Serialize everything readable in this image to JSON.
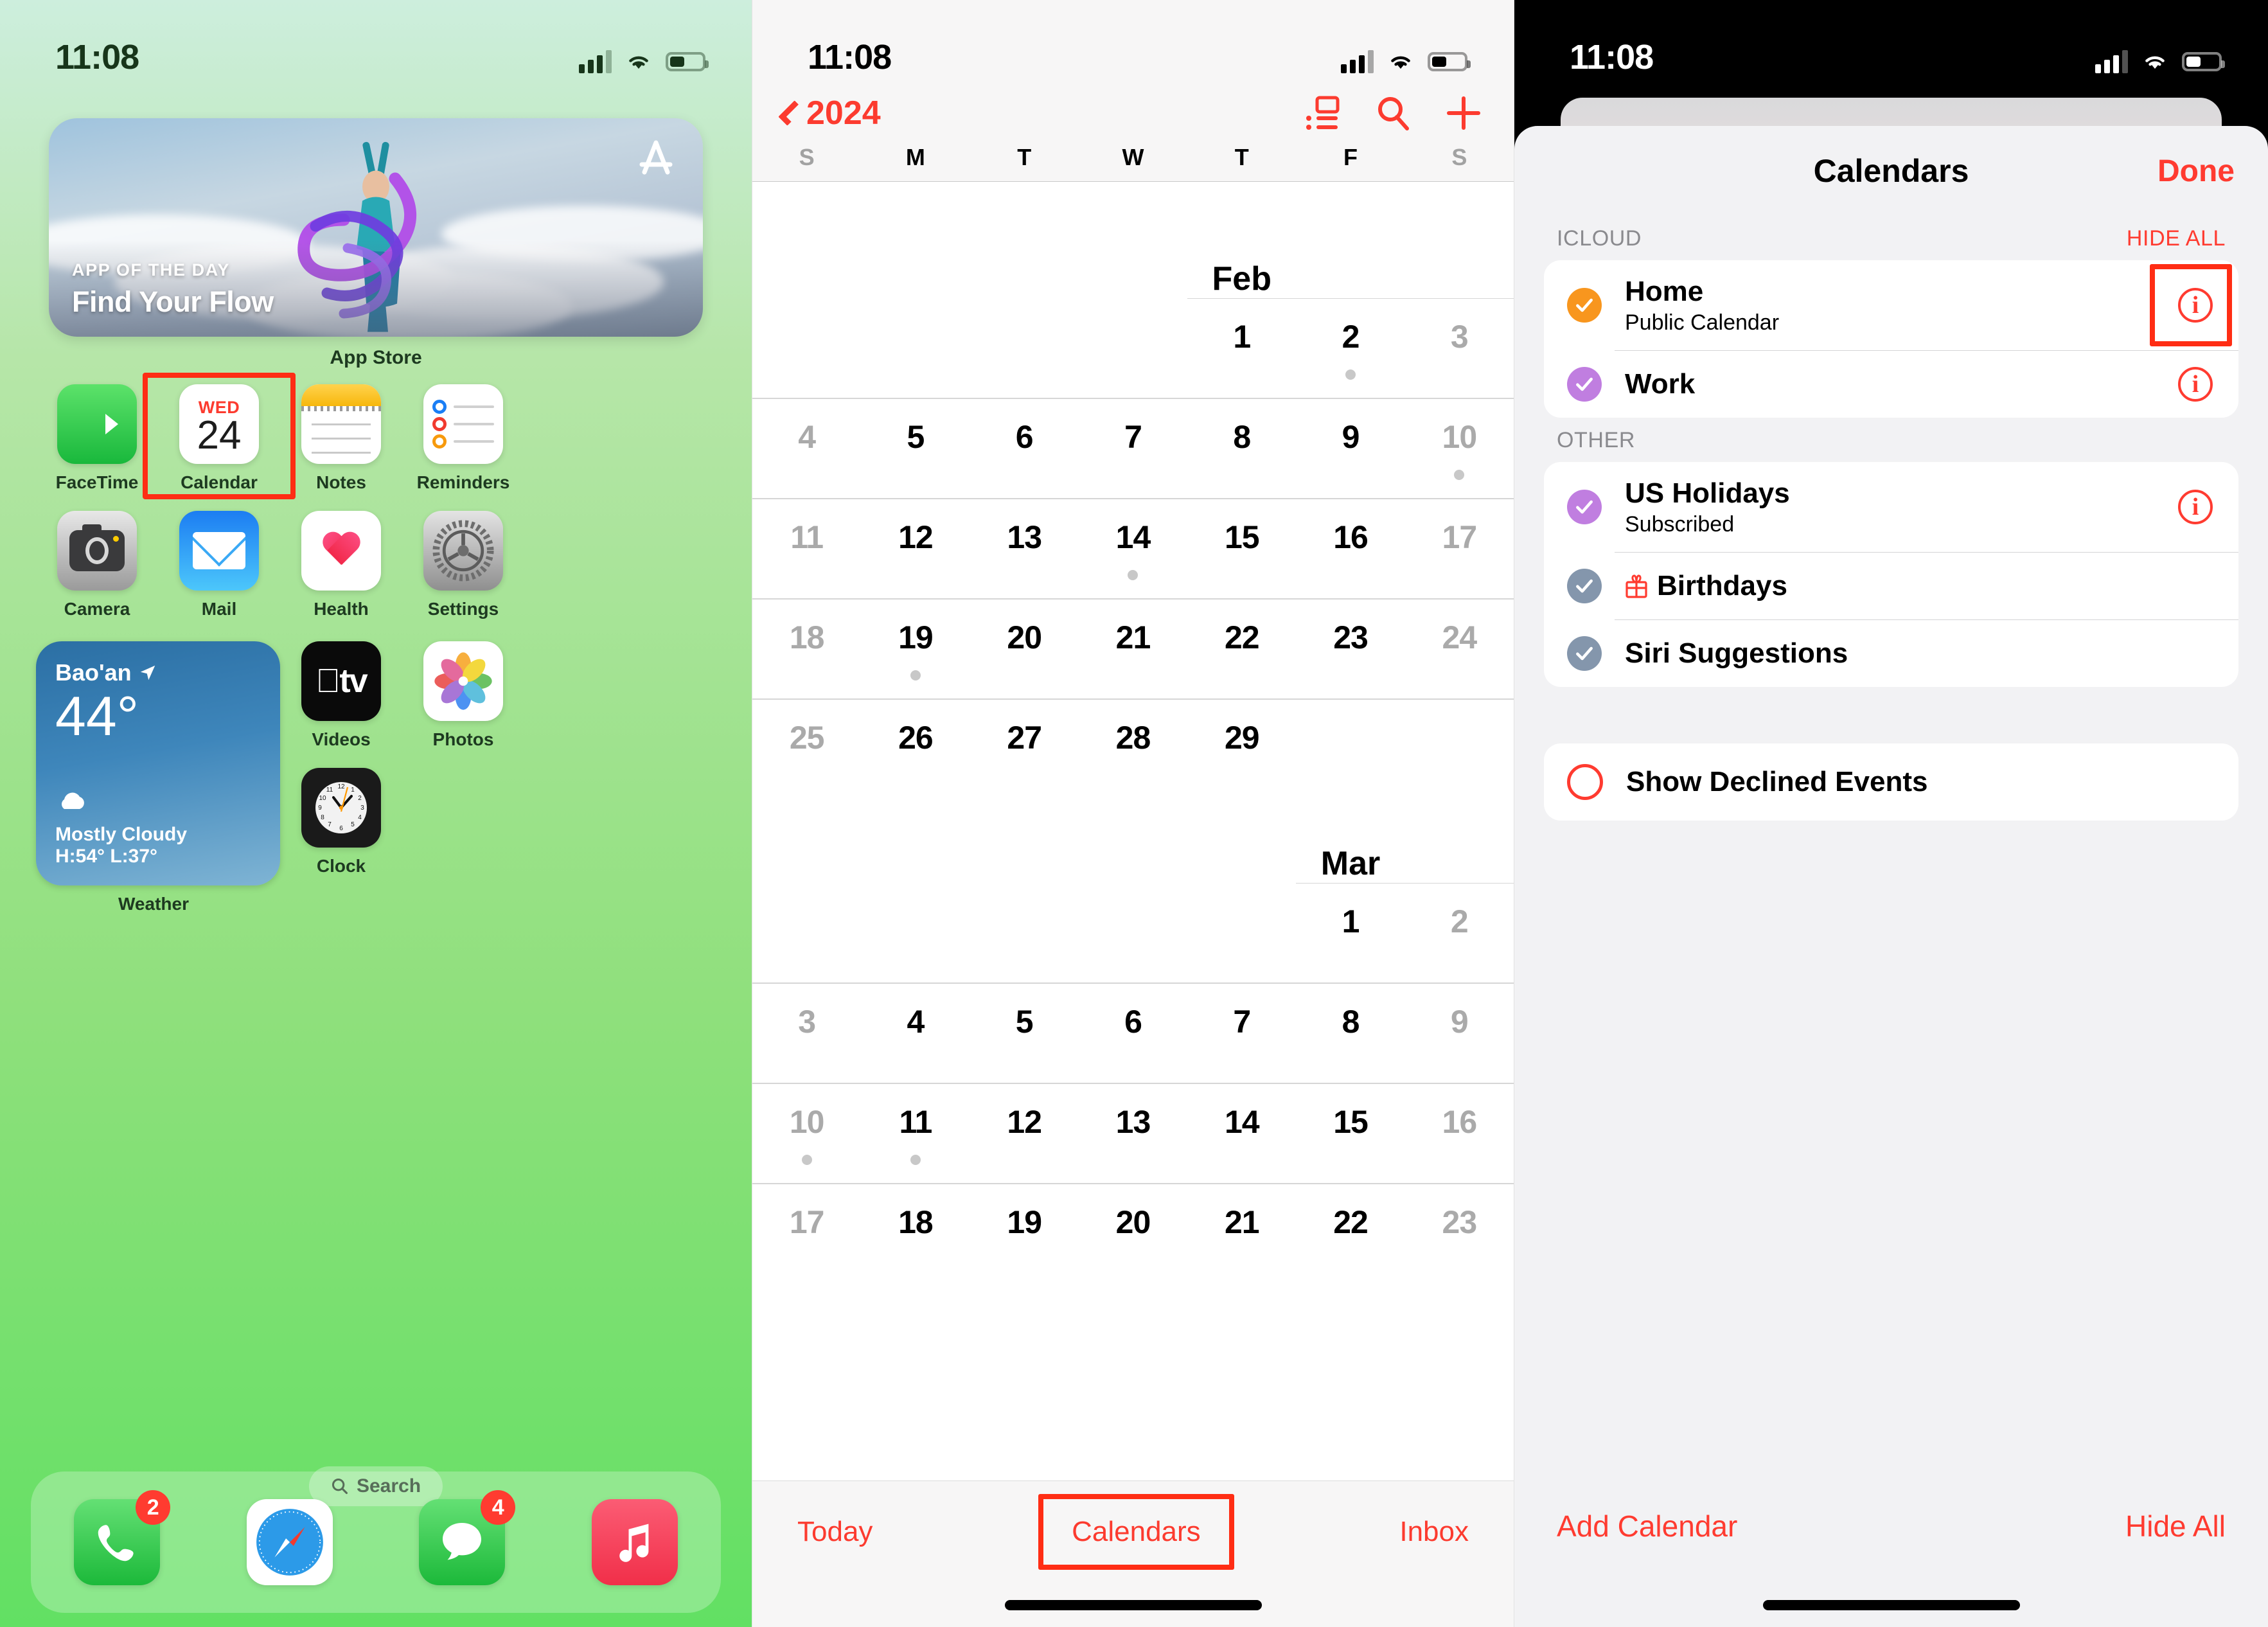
{
  "status_bar": {
    "time": "11:08",
    "icons": [
      "cellular-signal-icon",
      "wifi-icon",
      "battery-icon"
    ]
  },
  "home_screen": {
    "widget": {
      "kicker": "APP OF THE DAY",
      "title": "Find Your Flow",
      "label": "App Store",
      "icon": "app-store-icon"
    },
    "rows": [
      [
        {
          "label": "FaceTime",
          "icon": "facetime-icon",
          "selected": false
        },
        {
          "label": "Calendar",
          "icon": "calendar-icon",
          "selected": true,
          "dow": "WED",
          "day": "24"
        },
        {
          "label": "Notes",
          "icon": "notes-icon",
          "selected": false
        },
        {
          "label": "Reminders",
          "icon": "reminders-icon",
          "selected": false
        }
      ],
      [
        {
          "label": "Camera",
          "icon": "camera-icon",
          "selected": false
        },
        {
          "label": "Mail",
          "icon": "mail-icon",
          "selected": false
        },
        {
          "label": "Health",
          "icon": "health-icon",
          "selected": false
        },
        {
          "label": "Settings",
          "icon": "settings-icon",
          "selected": false
        }
      ]
    ],
    "weather": {
      "city": "Bao'an",
      "temp": "44°",
      "condition": "Mostly Cloudy",
      "high_low": "H:54° L:37°",
      "label": "Weather",
      "location_icon": "location-arrow-icon",
      "condition_icon": "cloud-icon"
    },
    "right_apps": [
      {
        "label": "Videos",
        "icon": "apple-tv-icon"
      },
      {
        "label": "Photos",
        "icon": "photos-icon"
      },
      {
        "label": "Clock",
        "icon": "clock-icon"
      }
    ],
    "search": {
      "label": "Search",
      "icon": "search-icon"
    },
    "dock": [
      {
        "name": "phone",
        "icon": "phone-icon",
        "badge": "2"
      },
      {
        "name": "safari",
        "icon": "safari-compass-icon",
        "badge": ""
      },
      {
        "name": "messages",
        "icon": "messages-bubble-icon",
        "badge": "4"
      },
      {
        "name": "music",
        "icon": "music-note-icon",
        "badge": ""
      }
    ]
  },
  "calendar_screen": {
    "year": "2024",
    "back_icon": "chevron-left-icon",
    "actions": [
      {
        "name": "list-view-button",
        "icon": "list-view-icon"
      },
      {
        "name": "search-button",
        "icon": "search-icon"
      },
      {
        "name": "add-event-button",
        "icon": "plus-icon"
      }
    ],
    "weekday_headers": [
      "S",
      "M",
      "T",
      "W",
      "T",
      "F",
      "S"
    ],
    "months": [
      {
        "name": "Feb",
        "weeks": [
          [
            "",
            "",
            "",
            "",
            "1",
            "2",
            "3"
          ],
          [
            "4",
            "5",
            "6",
            "7",
            "8",
            "9",
            "10"
          ],
          [
            "11",
            "12",
            "13",
            "14",
            "15",
            "16",
            "17"
          ],
          [
            "18",
            "19",
            "20",
            "21",
            "22",
            "23",
            "24"
          ],
          [
            "25",
            "26",
            "27",
            "28",
            "29",
            "",
            ""
          ]
        ],
        "event_days": [
          "2",
          "10",
          "14",
          "19"
        ]
      },
      {
        "name": "Mar",
        "weeks": [
          [
            "",
            "",
            "",
            "",
            "",
            "1",
            "2"
          ],
          [
            "3",
            "4",
            "5",
            "6",
            "7",
            "8",
            "9"
          ],
          [
            "10",
            "11",
            "12",
            "13",
            "14",
            "15",
            "16"
          ],
          [
            "17",
            "18",
            "19",
            "20",
            "21",
            "22",
            "23"
          ]
        ],
        "event_days": [
          "10",
          "11"
        ]
      }
    ],
    "tabs": [
      {
        "label": "Today",
        "selected": false
      },
      {
        "label": "Calendars",
        "selected": true
      },
      {
        "label": "Inbox",
        "selected": false
      }
    ]
  },
  "calendars_sheet": {
    "title": "Calendars",
    "done_label": "Done",
    "sections": [
      {
        "label": "ICLOUD",
        "action": "HIDE ALL",
        "rows": [
          {
            "title": "Home",
            "subtitle": "Public Calendar",
            "color": "#f8961e",
            "checked": true,
            "info": true,
            "info_selected": true
          },
          {
            "title": "Work",
            "subtitle": "",
            "color": "#c07ee0",
            "checked": true,
            "info": true,
            "info_selected": false
          }
        ]
      },
      {
        "label": "OTHER",
        "action": "",
        "rows": [
          {
            "title": "US Holidays",
            "subtitle": "Subscribed",
            "color": "#c07ee0",
            "checked": true,
            "info": true,
            "info_selected": false
          },
          {
            "title": "Birthdays",
            "subtitle": "",
            "color": "#8496ac",
            "checked": true,
            "info": false,
            "info_selected": false,
            "leading_icon": "gift-icon"
          },
          {
            "title": "Siri Suggestions",
            "subtitle": "",
            "color": "#8496ac",
            "checked": true,
            "info": false,
            "info_selected": false
          }
        ]
      }
    ],
    "declined": {
      "title": "Show Declined Events",
      "checked": false
    },
    "footer": {
      "add_label": "Add Calendar",
      "hide_label": "Hide All"
    }
  },
  "colors": {
    "accent_red": "#ff3b30",
    "highlight": "#ff2d14",
    "home_calendar": "#f8961e",
    "work_calendar": "#c07ee0",
    "other_calendar": "#8496ac"
  }
}
